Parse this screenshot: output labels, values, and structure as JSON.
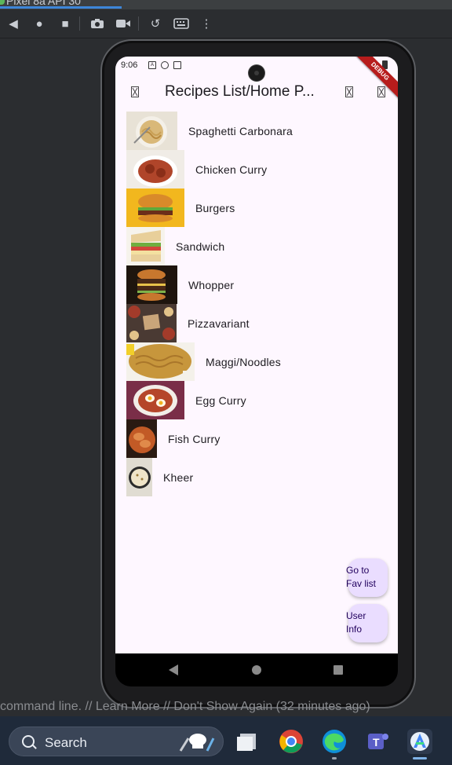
{
  "window": {
    "title": "Pixel 8a API 30"
  },
  "toolbar": {
    "icons": [
      "back-icon",
      "home-icon",
      "stop-icon",
      "camera-icon",
      "video-icon",
      "rotate-icon",
      "keyboard-icon",
      "more-icon"
    ]
  },
  "status_bar": {
    "time": "9:06",
    "debug_banner": "DEBUG"
  },
  "app_bar": {
    "title": "Recipes List/Home P...",
    "icons": [
      "drawer-icon",
      "action-icon",
      "action-icon"
    ]
  },
  "recipes": [
    {
      "name": "Spaghetti Carbonara",
      "color": "#d9c3a0"
    },
    {
      "name": "Chicken Curry",
      "color": "#b0452a"
    },
    {
      "name": "Burgers",
      "color": "#e8a21a"
    },
    {
      "name": "Sandwich",
      "color": "#a9b87f"
    },
    {
      "name": "Whopper",
      "color": "#3a2516"
    },
    {
      "name": "Pizzavariant",
      "color": "#5a463c"
    },
    {
      "name": "Maggi/Noodles",
      "color": "#c79a3c"
    },
    {
      "name": "Egg Curry",
      "color": "#7a2e48"
    },
    {
      "name": "Fish Curry",
      "color": "#a04a22"
    },
    {
      "name": "Kheer",
      "color": "#e2d7c0"
    }
  ],
  "fabs": {
    "fav": "Go to Fav list",
    "fav_line1": "Go to",
    "fav_line2": "Fav list",
    "user": "User Info",
    "user_line1": "User",
    "user_line2": "Info"
  },
  "ide": {
    "cmdline_text": "command line. // Learn More // Don't Show Again (32 minutes ago)"
  },
  "taskbar": {
    "search_label": "Search",
    "apps": [
      "file-explorer-icon",
      "chrome-icon",
      "edge-icon",
      "teams-icon",
      "android-studio-icon"
    ],
    "colors": {
      "chrome": "#db4437",
      "edge": "#0f8fd8",
      "teams": "#5b5fc7",
      "studio": "#3ddc84"
    }
  }
}
